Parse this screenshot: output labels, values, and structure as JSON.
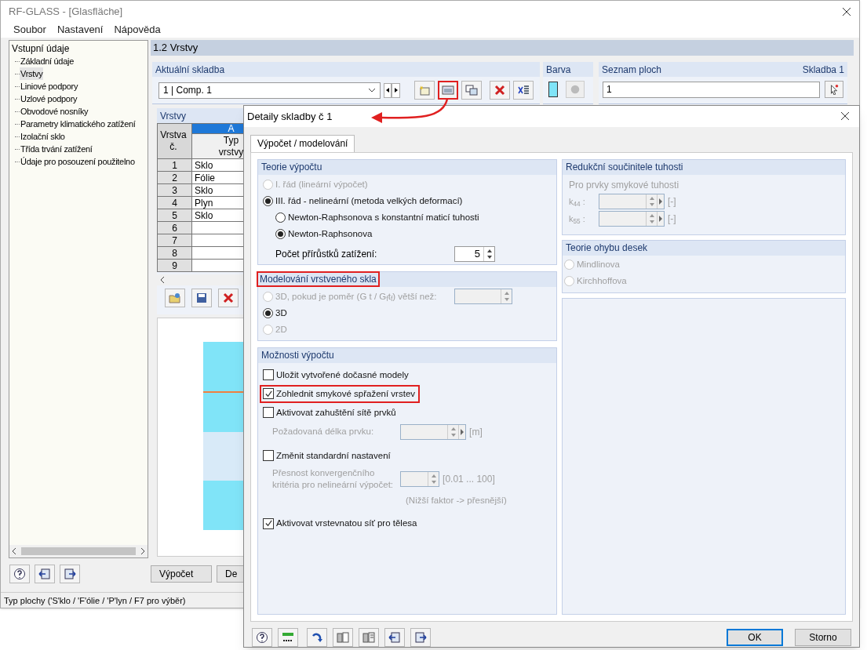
{
  "window": {
    "title": "RF-GLASS - [Glasfläche]"
  },
  "menu": [
    "Soubor",
    "Nastavení",
    "Nápověda"
  ],
  "navigator": {
    "root": "Vstupní údaje",
    "children": [
      {
        "label": "Základní údaje",
        "selected": false
      },
      {
        "label": "Vrstvy",
        "selected": true
      },
      {
        "label": "Liniové podpory",
        "selected": false
      },
      {
        "label": "Uzlové podpory",
        "selected": false
      },
      {
        "label": "Obvodové nosníky",
        "selected": false
      },
      {
        "label": "Parametry klimatického zatížení",
        "selected": false
      },
      {
        "label": "Izolační sklo",
        "selected": false
      },
      {
        "label": "Třída trvání zatížení",
        "selected": false
      },
      {
        "label": "Údaje pro posouzení použitelno",
        "selected": false
      }
    ]
  },
  "section_title": "1.2 Vrstvy",
  "composition": {
    "title": "Aktuální skladba",
    "value": "1 | Comp. 1",
    "toolbar": [
      {
        "highlighted": false
      },
      {
        "highlighted": true
      },
      {
        "highlighted": false
      },
      {
        "highlighted": false
      },
      {
        "highlighted": false
      }
    ]
  },
  "color_group": {
    "title": "Barva",
    "color": "#80e4f8"
  },
  "surfaces": {
    "title": "Seznam ploch",
    "tag": "Skladba 1",
    "value": "1"
  },
  "layers": {
    "title": "Vrstvy",
    "column_letter": "A",
    "columns": [
      "Vrstva č.",
      "Typ vrstvy"
    ],
    "rows": [
      {
        "number": "1",
        "type": "Sklo"
      },
      {
        "number": "2",
        "type": "Fólie"
      },
      {
        "number": "3",
        "type": "Sklo"
      },
      {
        "number": "4",
        "type": "Plyn"
      },
      {
        "number": "5",
        "type": "Sklo"
      },
      {
        "number": "6",
        "type": ""
      },
      {
        "number": "7",
        "type": ""
      },
      {
        "number": "8",
        "type": ""
      },
      {
        "number": "9",
        "type": ""
      }
    ]
  },
  "buttons": [
    "Výpočet",
    "De"
  ],
  "status_bar": "Typ plochy ('S'klo / 'F'ólie / 'P'lyn / F7 pro výběr)",
  "dialog": {
    "title": "Detaily skladby č 1",
    "tabs": [
      {
        "label": "Výpočet / modelování",
        "selected": true
      }
    ],
    "theory": {
      "title": "Teorie výpočtu",
      "options": [
        {
          "label": "I. řád (lineární výpočet)",
          "selected": false,
          "disabled": true
        },
        {
          "label": "III. řád - nelineární (metoda velkých deformací)",
          "selected": true,
          "disabled": false,
          "children": [
            {
              "label": "Newton-Raphsonova s konstantní maticí tuhosti",
              "selected": false,
              "disabled": false
            },
            {
              "label": "Newton-Raphsonova",
              "selected": true,
              "disabled": false
            }
          ]
        }
      ],
      "increments": {
        "label": "Počet přírůstků zatížení:",
        "value": "5"
      }
    },
    "laminated": {
      "title": "Modelování vrstveného skla",
      "highlighted": true,
      "options": [
        {
          "label": "3D, pokud je poměr (G t / G$_{f}$t$_{f}$) větší než:",
          "selected": false,
          "disabled": true,
          "field": {
            "disabled": true
          }
        },
        {
          "label": "3D",
          "selected": true,
          "disabled": false
        },
        {
          "label": "2D",
          "selected": false,
          "disabled": true
        }
      ]
    },
    "calc_options": {
      "title": "Možnosti výpočtu",
      "items": [
        {
          "label": "Uložit vytvořené dočasné modely",
          "checked": false
        },
        {
          "label": "Zohlednit smykové spřažení vrstev",
          "checked": true,
          "highlighted": true
        },
        {
          "label": "Aktivovat zahuštění sítě prvků",
          "checked": false,
          "field": {
            "label": "Požadovaná délka prvku:",
            "unit": "[m]"
          }
        },
        {
          "label": "Změnit standardní nastavení",
          "checked": false,
          "field": {
            "label": "Přesnost konvergenčního kritéria pro nelineární výpočet:",
            "unit": "[0.01 ... 100]",
            "note": "(Nižší faktor -> přesnější)"
          }
        },
        {
          "label": "Aktivovat vrstevnatou síť pro tělesa",
          "checked": true
        }
      ]
    },
    "stiffness": {
      "title": "Redukční součinitele tuhosti",
      "subtitle": "Pro prvky smykové tuhosti",
      "fields": [
        {
          "label": "k$_{44}$ :",
          "unit": "[-]"
        },
        {
          "label": "k$_{55}$ :",
          "unit": "[-]"
        }
      ]
    },
    "plate_theory": {
      "title": "Teorie ohybu desek",
      "options": [
        {
          "label": "Mindlinova",
          "selected": false,
          "disabled": true
        },
        {
          "label": "Kirchhoffova",
          "selected": false,
          "disabled": true
        }
      ]
    },
    "buttons": [
      {
        "label": "OK",
        "kind": "default"
      },
      {
        "label": "Storno",
        "kind": "normal"
      }
    ]
  }
}
